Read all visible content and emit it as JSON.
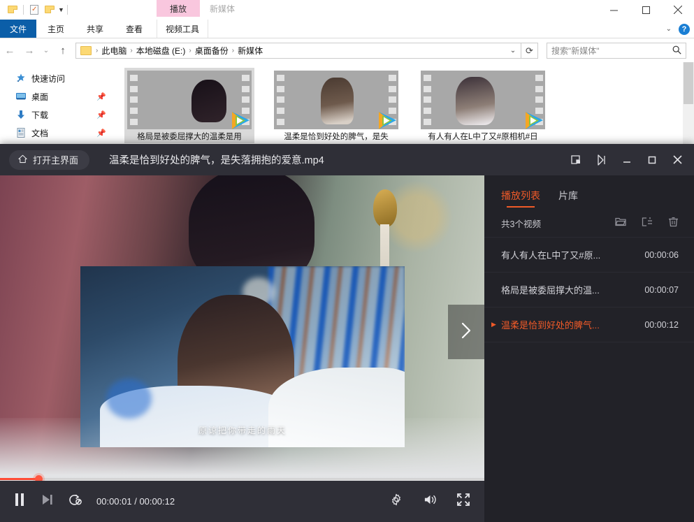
{
  "explorer": {
    "quick_access_toolbar": {
      "icons": [
        "folder-icon",
        "properties-icon",
        "new-folder-icon",
        "customize-caret-icon"
      ]
    },
    "contextual_tab_header": "播放",
    "contextual_tab_name": "新媒体",
    "window_controls": [
      "minimize",
      "maximize",
      "close"
    ],
    "ribbon": {
      "file_tab": "文件",
      "tabs": [
        "主页",
        "共享",
        "查看"
      ],
      "contextual_tab": "视频工具",
      "help_label": "?"
    },
    "address": {
      "back_icon": "back-arrow-icon",
      "forward_icon": "forward-arrow-icon",
      "recent_icon": "recent-locations-icon",
      "up_icon": "up-arrow-icon",
      "crumbs": [
        "此电脑",
        "本地磁盘 (E:)",
        "桌面备份",
        "新媒体"
      ],
      "dropdown_icon": "chevron-down-icon",
      "refresh_icon": "refresh-icon"
    },
    "search": {
      "placeholder": "搜索\"新媒体\"",
      "icon": "search-icon"
    },
    "nav_pane": {
      "items": [
        {
          "label": "快速访问",
          "icon": "quick-access-star-icon",
          "pinned": false
        },
        {
          "label": "桌面",
          "icon": "desktop-icon",
          "pinned": true
        },
        {
          "label": "下载",
          "icon": "downloads-icon",
          "pinned": true
        },
        {
          "label": "文档",
          "icon": "documents-icon",
          "pinned": true
        }
      ],
      "pin_icon": "pin-icon"
    },
    "files": [
      {
        "label": "格局是被委屈撑大的温柔是用",
        "selected": true,
        "art": "art1",
        "badge": "tencent-video-icon"
      },
      {
        "label": "温柔是恰到好处的脾气，是失",
        "selected": false,
        "art": "art2",
        "badge": "tencent-video-icon"
      },
      {
        "label": "有人有人在L中了又#原相机#日",
        "selected": false,
        "art": "art3",
        "badge": "tencent-video-icon"
      }
    ]
  },
  "player": {
    "home_button": {
      "label": "打开主界面",
      "icon": "home-icon"
    },
    "title": "温柔是恰到好处的脾气，是失落拥抱的爱意.mp4",
    "title_controls": [
      {
        "name": "mini-window-icon"
      },
      {
        "name": "cast-icon"
      },
      {
        "name": "minimize-icon"
      },
      {
        "name": "maximize-icon"
      },
      {
        "name": "close-icon"
      }
    ],
    "stage": {
      "subtitle": "原谅把你带走的雨天",
      "next_icon": "chevron-right-icon"
    },
    "playlist": {
      "tabs": [
        {
          "label": "播放列表",
          "active": true
        },
        {
          "label": "片库",
          "active": false
        }
      ],
      "count_label": "共3个视频",
      "actions": [
        {
          "name": "open-folder-icon"
        },
        {
          "name": "add-to-playlist-icon"
        },
        {
          "name": "delete-icon"
        }
      ],
      "items": [
        {
          "name": "有人有人在L中了又#原...",
          "time": "00:00:06",
          "active": false
        },
        {
          "name": "格局是被委屈撑大的温...",
          "time": "00:00:07",
          "active": false
        },
        {
          "name": "温柔是恰到好处的脾气...",
          "time": "00:00:12",
          "active": true
        }
      ]
    },
    "controls": {
      "pause_icon": "pause-icon",
      "next_icon": "next-track-icon",
      "repeat_icon": "repeat-off-icon",
      "current_time": "00:00:01",
      "separator": " / ",
      "total_time": "00:00:12",
      "time_display": "00:00:01 / 00:00:12",
      "settings_icon": "gear-icon",
      "volume_icon": "volume-icon",
      "fullscreen_icon": "fullscreen-icon",
      "progress_percent": 8
    },
    "colors": {
      "accent": "#f05a28",
      "progress": "#ff4a33",
      "panel_bg": "#222228",
      "bar_bg": "#2f2f37"
    }
  }
}
